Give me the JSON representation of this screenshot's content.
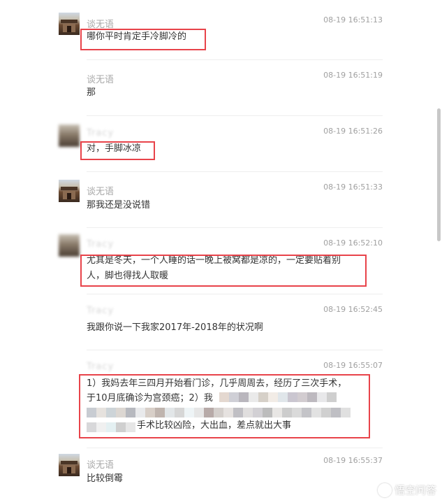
{
  "messages": [
    {
      "sender": "谈无语",
      "time": "08-19 16:51:13",
      "lines": [
        "哪你平时肯定手冷脚冷的"
      ]
    },
    {
      "sender": "谈无语",
      "time": "08-19 16:51:19",
      "lines": [
        "那"
      ]
    },
    {
      "sender": "Tracy",
      "time": "08-19 16:51:26",
      "lines": [
        "对，手脚冰凉"
      ]
    },
    {
      "sender": "谈无语",
      "time": "08-19 16:51:33",
      "lines": [
        "那我还是没说错"
      ]
    },
    {
      "sender": "Tracy",
      "time": "08-19 16:52:10",
      "lines": [
        "尤其是冬天，一个人睡的话一晚上被窝都是凉的，一定要贴着别",
        "人，脚也得找人取暖"
      ]
    },
    {
      "sender": "Tracy",
      "time": "08-19 16:52:45",
      "lines": [
        "我跟你说一下我家2017年-2018年的状况啊"
      ]
    },
    {
      "sender": "Tracy",
      "time": "08-19 16:55:07",
      "lines": [
        "1）我妈去年三四月开始看门诊，几乎周周去，经历了三次手术，",
        "于10月底确诊为宫颈癌；2）我",
        "手术比较凶险，大出血，差点就出大事"
      ]
    },
    {
      "sender": "谈无语",
      "time": "08-19 16:55:37",
      "lines": [
        "比较倒霉"
      ]
    }
  ],
  "watermark": {
    "text": "悟空问答",
    "icon": "wukong-logo-icon"
  },
  "colors": {
    "highlight": "#e8434a",
    "name": "#a8a8a8",
    "text": "#333333",
    "time": "#a0a0a0"
  }
}
